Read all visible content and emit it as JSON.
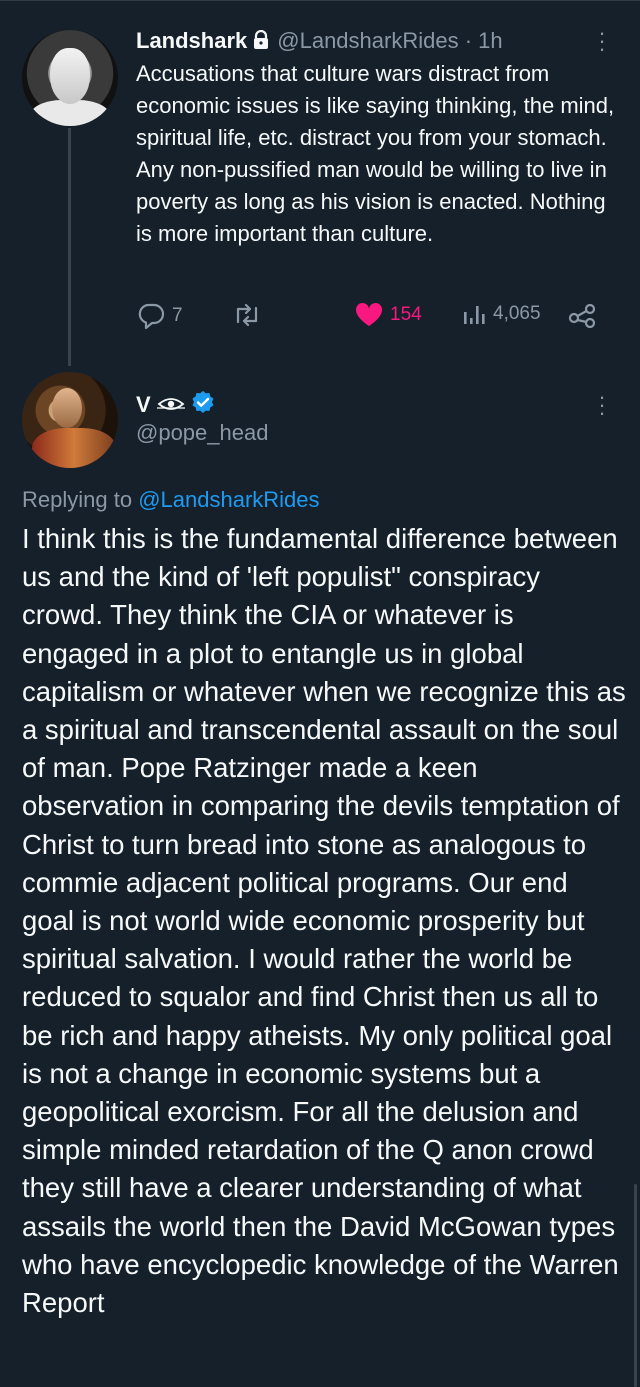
{
  "tweet1": {
    "name": "Landshark",
    "handle": "@LandsharkRides",
    "time": "· 1h",
    "text": "Accusations that culture wars distract from economic issues is like saying thinking, the mind, spiritual life, etc. distract you from your stomach. Any non-pussified man would be willing to live in poverty as long as his vision is enacted. Nothing is more important than culture.",
    "replies": "7",
    "retweets": "",
    "likes": "154",
    "views": "4,065",
    "icons": [
      "lock-icon",
      "reply-icon",
      "retweet-icon",
      "heart-icon",
      "views-icon",
      "share-icon",
      "more-icon"
    ],
    "like_color": "#f91880"
  },
  "tweet2": {
    "name": "V",
    "handle": "@pope_head",
    "replying_prefix": "Replying to",
    "replying_to": "@LandsharkRides",
    "text": "I think this is the fundamental difference between us and the kind of 'left populist\" conspiracy crowd. They think the CIA or whatever is engaged in a plot to entangle us in global capitalism or whatever when we recognize this as a spiritual and transcendental assault on the soul of man. Pope Ratzinger made a keen observation in comparing the devils temptation of Christ to turn bread into stone as analogous to commie adjacent political programs. Our end goal is not world wide economic prosperity but spiritual salvation. I would rather the world be reduced to squalor and find Christ then us all to be rich and happy atheists. My only political goal is not a change in economic systems but a geopolitical exorcism. For all the delusion and simple minded retardation of the Q anon crowd they still have a clearer understanding of what assails the world then the David McGowan types who have encyclopedic knowledge of the Warren Report",
    "icons": [
      "eye-icon",
      "verified-icon",
      "more-icon"
    ],
    "verified_color": "#1d9bf0"
  },
  "colors": {
    "background": "#15202b",
    "text": "#f7f9f9",
    "muted": "#8b98a5",
    "link": "#1d9bf0"
  }
}
